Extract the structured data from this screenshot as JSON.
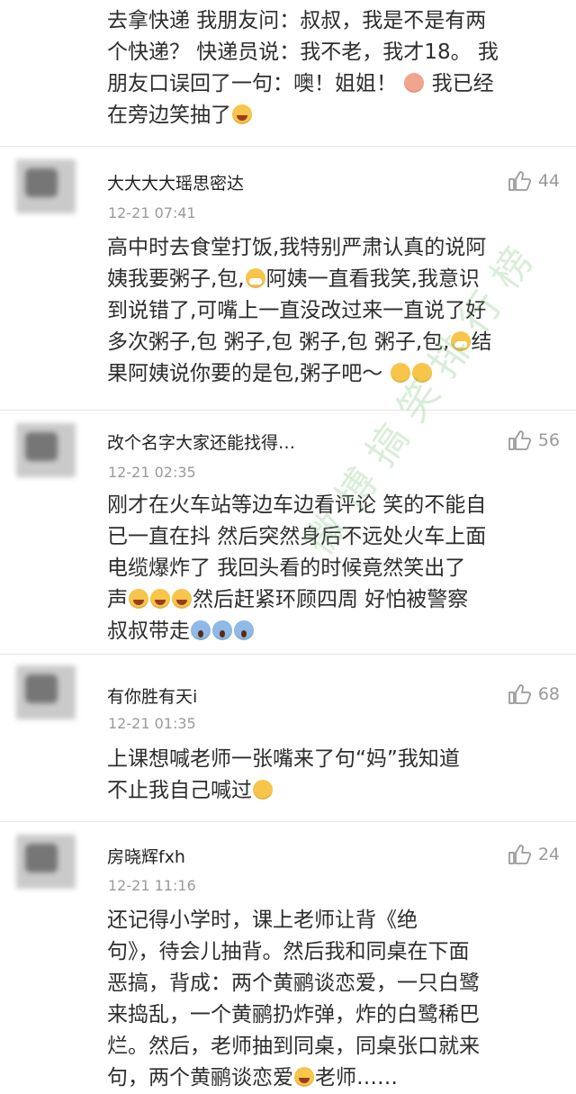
{
  "top_comment": {
    "lines": [
      "去拿快递 我朋友问：叔叔，我是不是有两",
      "个快递？ 快递员说：我不老，我才18。 我",
      "朋友口误回了一句：噢！姐姐！",
      "在旁边笑抽了"
    ],
    "line3_tail": "我已经"
  },
  "comments": [
    {
      "username": "大大大大瑶思密达",
      "time": "12-21 07:41",
      "likes": "44",
      "lines": [
        "高中时去食堂打饭,我特别严肃认真的说阿",
        "姨我要粥子,包,",
        "阿姨一直看我笑,我意识",
        "到说错了,可嘴上一直没改过来一直说了好",
        "多次粥子,包 粥子,包 粥子,包 粥子,包,",
        "结",
        "果阿姨说你要的是包,粥子吧～"
      ]
    },
    {
      "username": "改个名字大家还能找得…",
      "time": "12-21 02:35",
      "likes": "56",
      "lines": [
        "刚才在火车站等边车边看评论 笑的不能自",
        "已一直在抖 然后突然身后不远处火车上面",
        "电缆爆炸了 我回头看的时候竟然笑出了",
        "声",
        "然后赶紧环顾四周 好怕被警察",
        "叔叔带走"
      ]
    },
    {
      "username": "有你胜有天i",
      "time": "12-21 01:35",
      "likes": "68",
      "lines": [
        "上课想喊老师一张嘴来了句“妈”我知道",
        "不止我自己喊过"
      ]
    },
    {
      "username": "房晓辉fxh",
      "time": "12-21 11:16",
      "likes": "24",
      "lines": [
        "还记得小学时，课上老师让背《绝",
        "句》，待会儿抽背。然后我和同桌在下面",
        "恶搞，背成：两个黄鹂谈恋爱，一只白鹭",
        "来捣乱，一个黄鹂扔炸弹，炸的白鹭稀巴",
        "烂。然后，老师抽到同桌，同桌张口就来",
        "句，两个黄鹂谈恋爱",
        "老师……"
      ]
    }
  ],
  "watermark": "微博搞笑排行榜",
  "colors": {
    "text": "#2d2d2d",
    "meta": "#9a9a9a",
    "divider": "#e6e6e6"
  },
  "icons": {
    "like": "thumbs-up-icon"
  }
}
